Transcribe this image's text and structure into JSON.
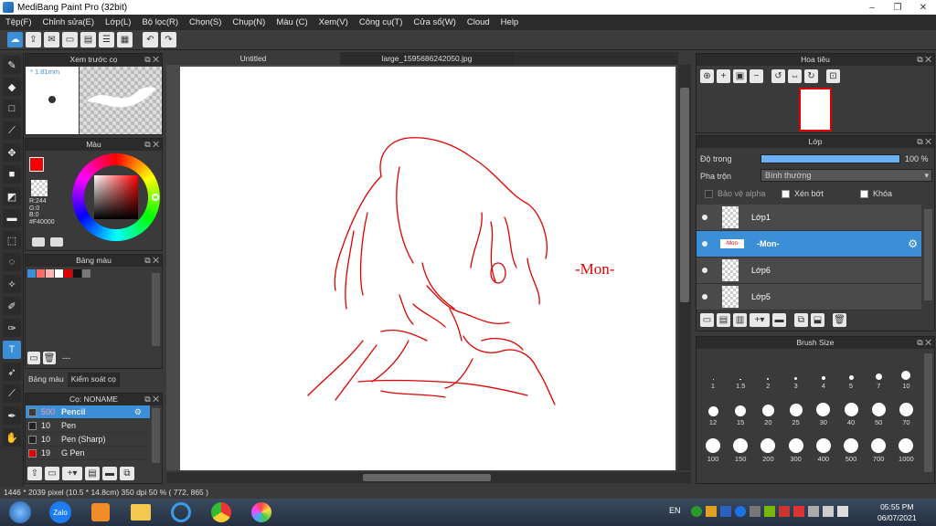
{
  "window": {
    "title": "MediBang Paint Pro (32bit)"
  },
  "menu": [
    "Tệp(F)",
    "Chỉnh sửa(E)",
    "Lớp(L)",
    "Bộ lọc(R)",
    "Chọn(S)",
    "Chụp(N)",
    "Màu (C)",
    "Xem(V)",
    "Công cụ(T)",
    "Cửa sổ(W)",
    "Cloud",
    "Help"
  ],
  "tabs": [
    "Untitled",
    "large_1595686242050.jpg"
  ],
  "brush_preview": {
    "title": "Xem trước cọ",
    "size": "1.81mm"
  },
  "color": {
    "title": "Màu",
    "r": "R:244",
    "g": "G:0",
    "b": "B:0",
    "hex": "#F40000",
    "fg": "#f40000"
  },
  "palette": {
    "title": "Bảng màu",
    "colors": [
      "#3a8fd6",
      "#ff6b6b",
      "#ffb3b3",
      "#ffffff",
      "#e00000",
      "#111111",
      "#777777"
    ],
    "footer": "---"
  },
  "left_tabs": [
    "Bảng màu",
    "Kiểm soát cọ"
  ],
  "brushes": {
    "title": "Cọ: NONAME",
    "items": [
      {
        "size": "500",
        "name": "Pencil",
        "color": "#3a3a3a",
        "selected": true
      },
      {
        "size": "10",
        "name": "Pen",
        "color": "#222222",
        "selected": false
      },
      {
        "size": "10",
        "name": "Pen (Sharp)",
        "color": "#222222",
        "selected": false
      },
      {
        "size": "19",
        "name": "G Pen",
        "color": "#e00000",
        "selected": false
      }
    ]
  },
  "navigator": {
    "title": "Hoa tiêu"
  },
  "layers": {
    "title": "Lớp",
    "opacity_label": "Độ trong",
    "opacity_value": "100 %",
    "blend_label": "Pha trộn",
    "blend_value": "Bình thường",
    "protect_alpha": "Bảo vệ alpha",
    "clipping": "Xén bớt",
    "lock": "Khóa",
    "items": [
      {
        "name": "Lớp1",
        "selected": false
      },
      {
        "name": "-Mon-",
        "selected": true
      },
      {
        "name": "Lớp6",
        "selected": false
      },
      {
        "name": "Lớp5",
        "selected": false
      }
    ]
  },
  "brush_size": {
    "title": "Brush Size",
    "sizes": [
      "1",
      "1.5",
      "2",
      "3",
      "4",
      "5",
      "7",
      "10",
      "12",
      "15",
      "20",
      "25",
      "30",
      "40",
      "50",
      "70",
      "100",
      "150",
      "200",
      "300",
      "400",
      "500",
      "700",
      "1000"
    ]
  },
  "canvas": {
    "watermark": "-Mon-"
  },
  "status": {
    "text": "1446 * 2039 pixel  (10.5 * 14.8cm)  350 dpi  50 %  ( 772, 865 )"
  },
  "taskbar": {
    "lang": "EN",
    "time": "05:55 PM",
    "date": "06/07/2021",
    "apps": [
      "Zalo"
    ]
  }
}
